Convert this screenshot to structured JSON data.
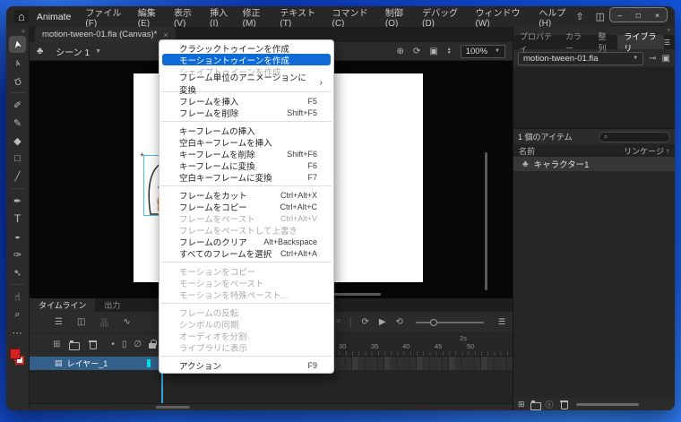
{
  "titlebar": {
    "app_name": "Animate",
    "menus": [
      "ファイル(F)",
      "編集(E)",
      "表示(V)",
      "挿入(I)",
      "修正(M)",
      "テキスト(T)",
      "コマンド(C)",
      "制御(O)",
      "デバッグ(D)",
      "ウィンドウ(W)",
      "ヘルプ(H)"
    ],
    "window_controls": {
      "minimize": "–",
      "maximize": "□",
      "close": "×"
    }
  },
  "document": {
    "tab_title": "motion-tween-01.fla (Canvas)*",
    "close_label": "×",
    "scene_label": "シーン 1",
    "zoom_level": "100%"
  },
  "toolbar": {
    "tools": [
      {
        "name": "selection-tool",
        "glyph": "➤",
        "state": "active"
      },
      {
        "name": "subselection-tool",
        "glyph": "➢"
      },
      {
        "name": "lasso-tool",
        "glyph": "Ω"
      },
      {
        "type": "divider"
      },
      {
        "name": "fluid-brush-tool",
        "glyph": "✐"
      },
      {
        "name": "classic-brush-tool",
        "glyph": "✎"
      },
      {
        "name": "eraser-tool",
        "glyph": "◆"
      },
      {
        "name": "rectangle-tool",
        "glyph": "□"
      },
      {
        "name": "line-tool",
        "glyph": "╱"
      },
      {
        "type": "divider"
      },
      {
        "name": "pen-tool",
        "glyph": "✒"
      },
      {
        "name": "text-tool",
        "glyph": "T"
      },
      {
        "name": "paint-bucket-tool",
        "glyph": "◒"
      },
      {
        "name": "eyedropper-tool",
        "glyph": "✑"
      },
      {
        "name": "asset-warp-tool",
        "glyph": "➴"
      },
      {
        "type": "divider"
      },
      {
        "name": "hand-tool",
        "glyph": "☝"
      },
      {
        "name": "zoom-tool",
        "glyph": "⌕"
      },
      {
        "name": "more-tools",
        "glyph": "⋯"
      }
    ]
  },
  "scene_bar_icons": [
    {
      "name": "center-stage-icon",
      "glyph": "⊕"
    },
    {
      "name": "rotation-tool-icon",
      "glyph": "⟳"
    },
    {
      "name": "clip-content-icon",
      "glyph": "▣"
    }
  ],
  "context_menu": {
    "items": [
      {
        "name": "menu-create-classic-tween",
        "label": "クラシックトゥイーンを作成"
      },
      {
        "name": "menu-create-motion-tween",
        "label": "モーショントゥイーンを作成",
        "state": "highlighted"
      },
      {
        "name": "menu-create-shape-tween",
        "label": "シェイプトゥイーンを作成",
        "state": "disabled"
      },
      {
        "name": "menu-convert-to-frame-by-frame",
        "label": "フレーム単位のアニメーションに変換",
        "arrow": "›"
      },
      {
        "type": "separator"
      },
      {
        "name": "menu-insert-frame",
        "label": "フレームを挿入",
        "shortcut": "F5"
      },
      {
        "name": "menu-remove-frames",
        "label": "フレームを削除",
        "shortcut": "Shift+F5"
      },
      {
        "type": "separator"
      },
      {
        "name": "menu-insert-keyframe",
        "label": "キーフレームの挿入"
      },
      {
        "name": "menu-insert-blank-keyframe",
        "label": "空白キーフレームを挿入"
      },
      {
        "name": "menu-delete-keyframe",
        "label": "キーフレームを削除",
        "shortcut": "Shift+F6"
      },
      {
        "name": "menu-convert-to-keyframes",
        "label": "キーフレームに変換",
        "shortcut": "F6"
      },
      {
        "name": "menu-convert-to-blank-keyframes",
        "label": "空白キーフレームに変換",
        "shortcut": "F7"
      },
      {
        "type": "separator"
      },
      {
        "name": "menu-cut-frames",
        "label": "フレームをカット",
        "shortcut": "Ctrl+Alt+X"
      },
      {
        "name": "menu-copy-frames",
        "label": "フレームをコピー",
        "shortcut": "Ctrl+Alt+C"
      },
      {
        "name": "menu-paste-frames",
        "label": "フレームをペースト",
        "shortcut": "Ctrl+Alt+V",
        "state": "disabled"
      },
      {
        "name": "menu-paste-and-overwrite-frames",
        "label": "フレームをペーストして上書き",
        "state": "disabled"
      },
      {
        "name": "menu-clear-frames",
        "label": "フレームのクリア",
        "shortcut": "Alt+Backspace"
      },
      {
        "name": "menu-select-all-frames",
        "label": "すべてのフレームを選択",
        "shortcut": "Ctrl+Alt+A"
      },
      {
        "type": "separator"
      },
      {
        "name": "menu-copy-motion",
        "label": "モーションをコピー",
        "state": "disabled"
      },
      {
        "name": "menu-paste-motion",
        "label": "モーションをペースト",
        "state": "disabled"
      },
      {
        "name": "menu-paste-motion-special",
        "label": "モーションを特殊ペースト...",
        "state": "disabled"
      },
      {
        "type": "separator"
      },
      {
        "name": "menu-reverse-frames",
        "label": "フレームの反転",
        "state": "disabled"
      },
      {
        "name": "menu-synchronize-symbols",
        "label": "シンボルの同期",
        "state": "disabled"
      },
      {
        "name": "menu-split-audio",
        "label": "オーディオを分割",
        "state": "disabled"
      },
      {
        "name": "menu-show-in-library",
        "label": "ライブラリに表示",
        "state": "disabled"
      },
      {
        "type": "separator"
      },
      {
        "name": "menu-actions",
        "label": "アクション",
        "shortcut": "F9"
      }
    ]
  },
  "timeline": {
    "tabs": [
      {
        "name": "tab-timeline",
        "label": "タイムライン",
        "state": "active"
      },
      {
        "name": "tab-output",
        "label": "出力"
      }
    ],
    "controls_left": [
      {
        "name": "layers-icon",
        "glyph": "☰"
      },
      {
        "name": "camera-icon",
        "glyph": "◫"
      },
      {
        "name": "parent-view-icon",
        "glyph": "品",
        "state": "disabled"
      },
      {
        "name": "graph-editor-icon",
        "glyph": "∿"
      }
    ],
    "controls_right": [
      {
        "name": "onion-skin-icon",
        "glyph": "◉"
      },
      {
        "name": "onion-outlines-icon",
        "glyph": "回"
      },
      {
        "name": "edit-multiple-frames-icon",
        "glyph": "⋈"
      },
      {
        "name": "frame-markers-icon",
        "glyph": "⌗",
        "state": "disabled"
      },
      {
        "type": "divider"
      },
      {
        "name": "loop-icon",
        "glyph": "⟳"
      },
      {
        "name": "play-icon",
        "glyph": "▶"
      },
      {
        "name": "rewind-icon",
        "glyph": "⟲"
      }
    ],
    "layer_tools": [
      {
        "name": "new-layer-icon",
        "glyph": "⊞"
      },
      {
        "name": "new-folder-icon",
        "glyph": ""
      },
      {
        "name": "delete-icon",
        "glyph": ""
      }
    ],
    "layer_columns": [
      {
        "name": "highlight-column-icon",
        "glyph": "•"
      },
      {
        "name": "outline-column-icon",
        "glyph": "▯"
      },
      {
        "name": "hide-column-icon",
        "glyph": "∅"
      },
      {
        "name": "lock-column-icon",
        "glyph": ""
      }
    ],
    "layer": {
      "name": "レイヤー_1"
    },
    "ruler": {
      "time_marker": "2s",
      "numbers": [
        "30",
        "35",
        "40",
        "45",
        "50"
      ]
    }
  },
  "right_panel": {
    "tabs": [
      {
        "name": "tab-properties",
        "label": "プロパティ"
      },
      {
        "name": "tab-color",
        "label": "カラー"
      },
      {
        "name": "tab-align",
        "label": "整列"
      },
      {
        "name": "tab-library",
        "label": "ライブラリ",
        "state": "active"
      }
    ],
    "library": {
      "document_name": "motion-tween-01.fla",
      "item_count": "1 個のアイテム",
      "columns": {
        "name": "名前",
        "linkage": "リンケージ"
      },
      "items": [
        {
          "name": "キャラクター1"
        }
      ],
      "bottom_icons": [
        {
          "name": "new-symbol-icon",
          "glyph": "⊞"
        },
        {
          "name": "new-folder-icon",
          "glyph": ""
        },
        {
          "name": "item-properties-icon",
          "glyph": "ⓘ"
        },
        {
          "name": "delete-icon",
          "glyph": ""
        }
      ]
    }
  },
  "colors": {
    "menu_highlight": "#0e6bd6",
    "layer_selected": "#33608a",
    "playhead": "#2fa3e0",
    "selection_outline": "#43bfeb",
    "layer_swatch_cyan": "#00e0e6",
    "fill_swatch_red": "#d21f1f",
    "desktop_blue": "#1150d6"
  }
}
